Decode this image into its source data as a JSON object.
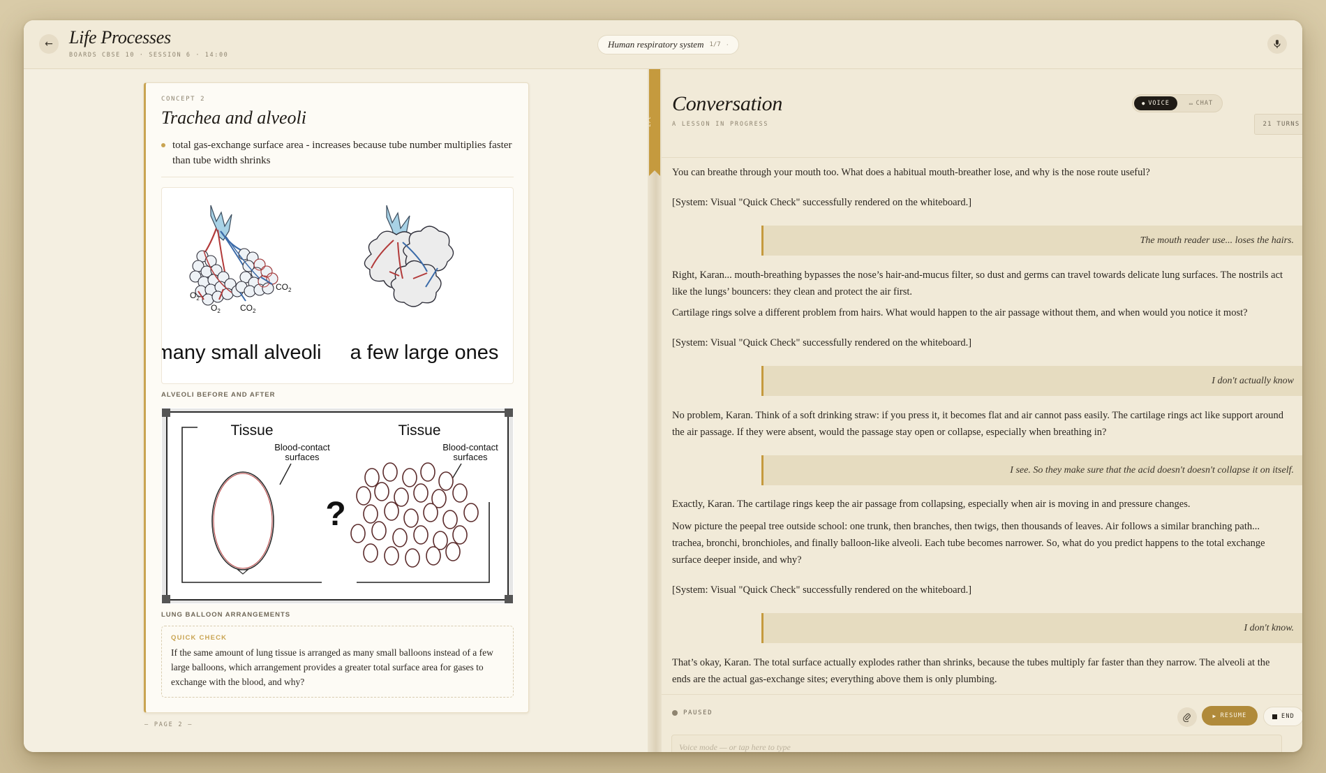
{
  "header": {
    "title": "Life Processes",
    "subtitle": "BOARDS CBSE 10 · SESSION 6 · 14:00",
    "topic": "Human respiratory system",
    "topic_progress": "1/7",
    "topic_dot": "·"
  },
  "lesson": {
    "concept_label": "CONCEPT 2",
    "concept_title": "Trachea and alveoli",
    "bullet": "total gas-exchange surface area - increases because tube number multiplies faster than tube width shrinks",
    "figure1": {
      "left_label": "many small alveoli",
      "right_label": "a few large ones",
      "o2": "O",
      "co2": "CO",
      "caption": "ALVEOLI BEFORE AND AFTER"
    },
    "figure2": {
      "tissue_left": "Tissue",
      "tissue_right": "Tissue",
      "blood_contact": "Blood-contact",
      "surfaces": "surfaces",
      "question_mark": "?",
      "caption": "LUNG BALLOON ARRANGEMENTS"
    },
    "quick_check": {
      "label": "QUICK CHECK",
      "text": "If the same amount of lung tissue is arranged as many small balloons instead of a few large balloons, which arrangement provides a greater total surface area for gases to exchange with the blood, and why?"
    },
    "page_number": "— PAGE 2 —"
  },
  "ribbon": {
    "text": "1/7"
  },
  "conversation": {
    "title": "Conversation",
    "subtitle": "A LESSON IN PROGRESS",
    "mode_voice": "VOICE",
    "mode_chat": "CHAT",
    "turns": "21 TURNS",
    "messages": [
      {
        "role": "tutor",
        "text": "You can breathe through your mouth too. What does a habitual mouth-breather lose, and why is the nose route useful?"
      },
      {
        "role": "system",
        "text": "[System: Visual \"Quick Check\" successfully rendered on the whiteboard.]"
      },
      {
        "role": "student",
        "text": "The mouth reader use... loses the hairs."
      },
      {
        "role": "tutor",
        "text": "Right, Karan... mouth-breathing bypasses the nose’s hair-and-mucus filter, so dust and germs can travel towards delicate lung surfaces. The nostrils act like the lungs’ bouncers: they clean and protect the air first."
      },
      {
        "role": "tutor",
        "text": "Cartilage rings solve a different problem from hairs. What would happen to the air passage without them, and when would you notice it most?"
      },
      {
        "role": "system",
        "text": "[System: Visual \"Quick Check\" successfully rendered on the whiteboard.]"
      },
      {
        "role": "student",
        "text": "I don't actually know"
      },
      {
        "role": "tutor",
        "text": "No problem, Karan. Think of a soft drinking straw: if you press it, it becomes flat and air cannot pass easily. The cartilage rings act like support around the air passage. If they were absent, would the passage stay open or collapse, especially when breathing in?"
      },
      {
        "role": "student",
        "text": "I see. So they make sure that the acid doesn't doesn't collapse it on itself."
      },
      {
        "role": "tutor",
        "text": "Exactly, Karan. The cartilage rings keep the air passage from collapsing, especially when air is moving in and pressure changes."
      },
      {
        "role": "tutor",
        "text": "Now picture the peepal tree outside school: one trunk, then branches, then twigs, then thousands of leaves. Air follows a similar branching path... trachea, bronchi, bronchioles, and finally balloon-like alveoli. Each tube becomes narrower. So, what do you predict happens to the total exchange surface deeper inside, and why?"
      },
      {
        "role": "system",
        "text": "[System: Visual \"Quick Check\" successfully rendered on the whiteboard.]"
      },
      {
        "role": "student",
        "text": "I don't know."
      },
      {
        "role": "tutor",
        "text": "That’s okay, Karan. The total surface actually explodes rather than shrinks, because the tubes multiply far faster than they narrow. The alveoli at the ends are the actual gas-exchange sites; everything above them is only plumbing."
      }
    ],
    "status": "PAUSED",
    "resume_label": "RESUME",
    "end_label": "END",
    "input_placeholder": "Voice mode — or tap here to type"
  },
  "icons": {
    "back": "arrow-left-icon",
    "mic": "microphone-icon",
    "attach": "paperclip-icon",
    "play": "play-icon",
    "stop": "stop-icon"
  },
  "colors": {
    "accent_gold": "#c59a3e",
    "resume_bg": "#b08a3a",
    "page_bg": "#f4efe1",
    "student_bubble": "#e6dcc0",
    "voice_pill": "#1f1b16"
  }
}
